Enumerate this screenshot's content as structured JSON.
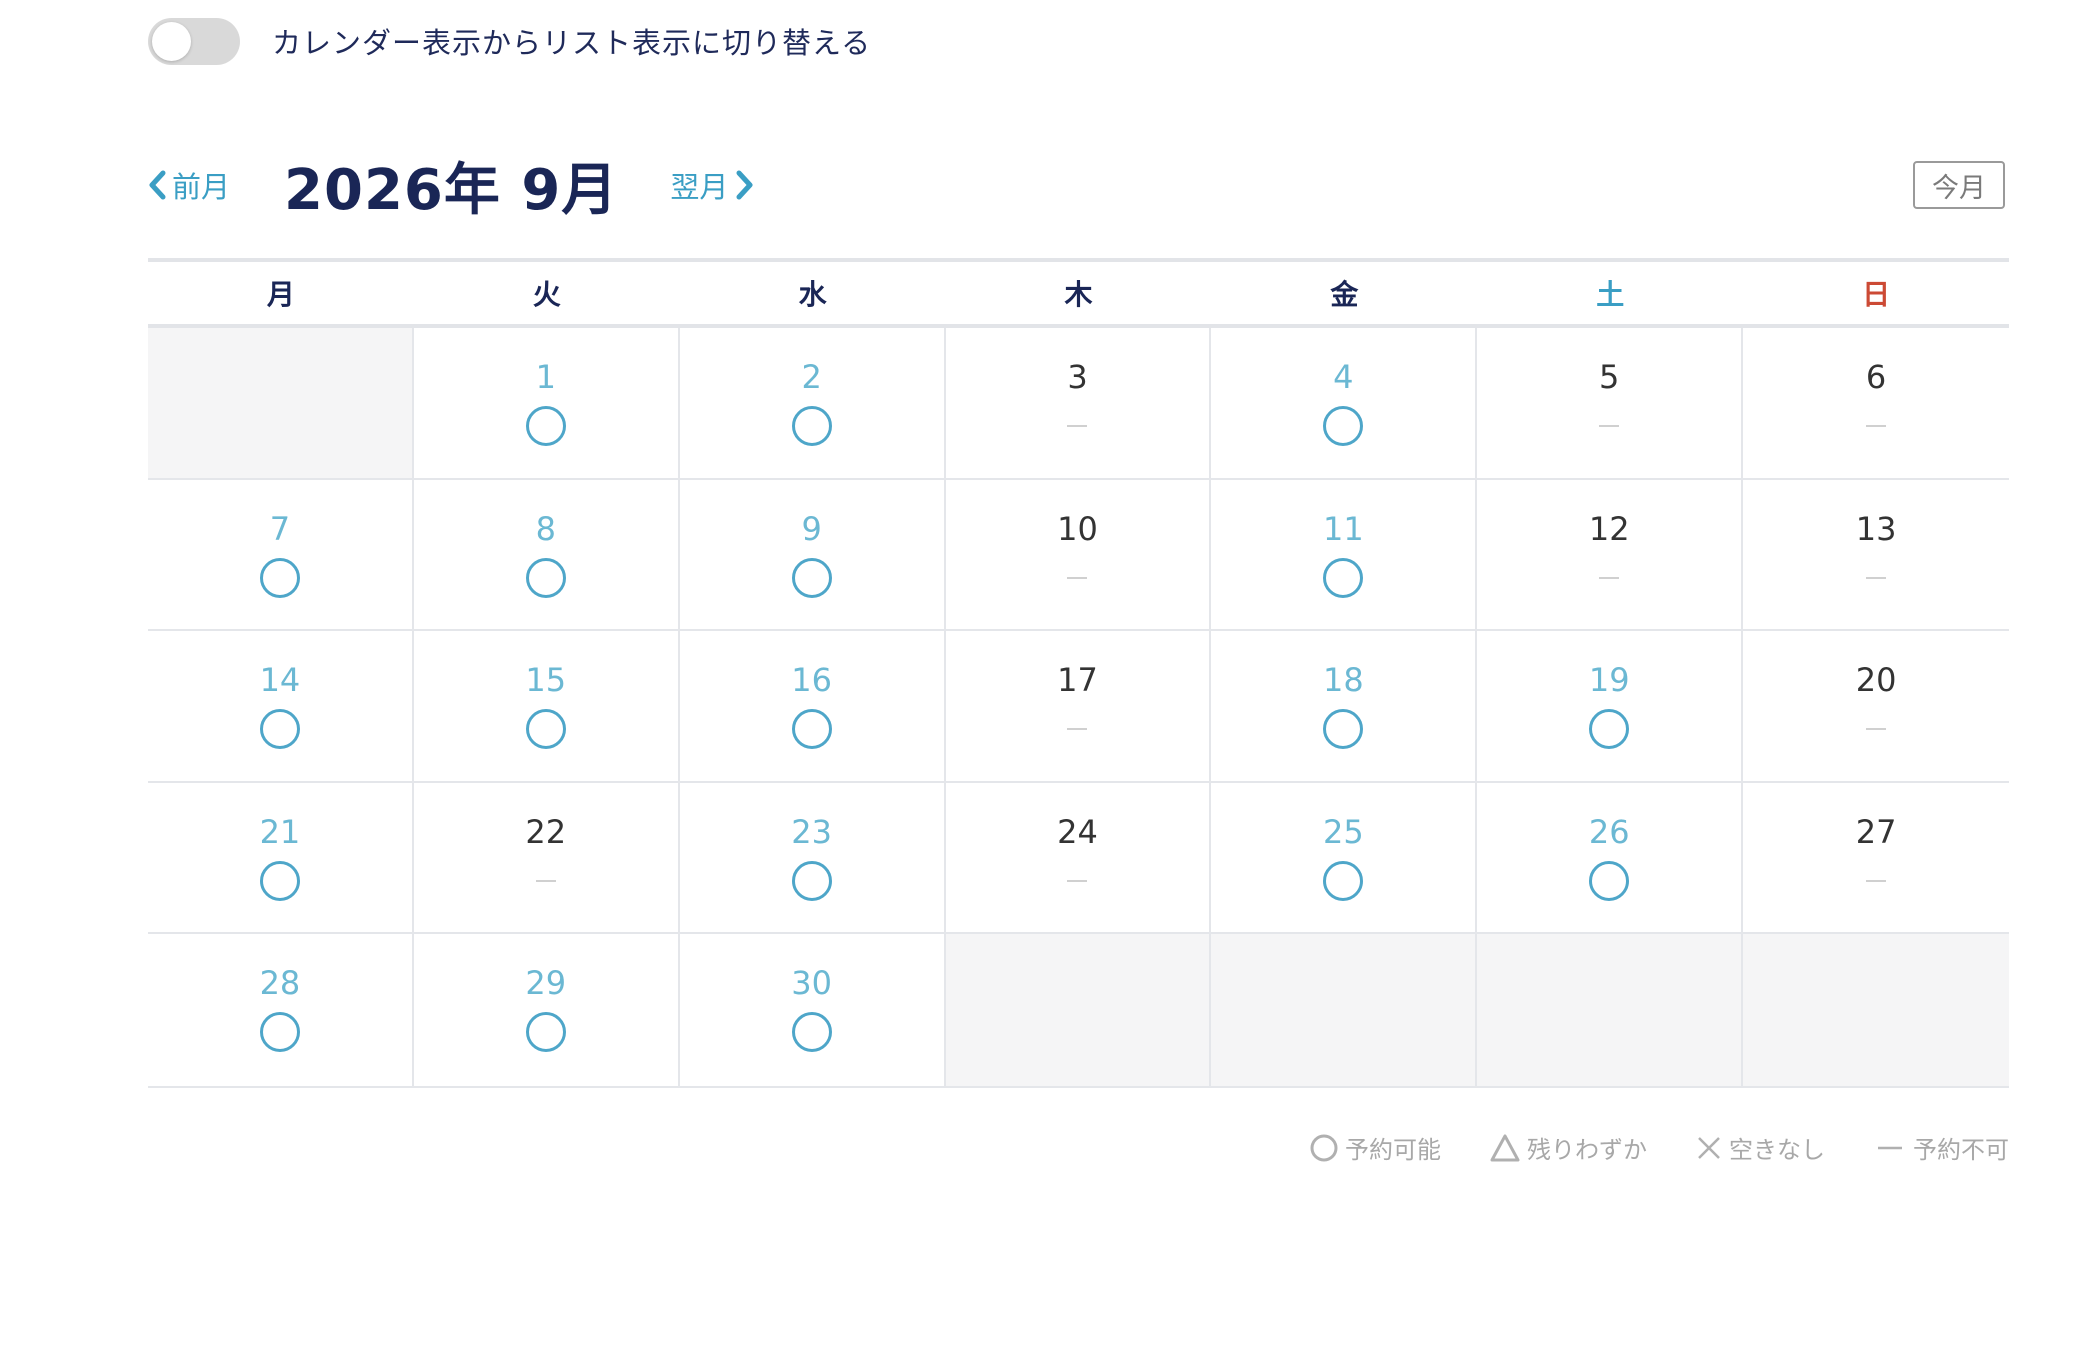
{
  "toggle": {
    "label": "カレンダー表示からリスト表示に切り替える",
    "on": false
  },
  "nav": {
    "prev_label": "前月",
    "next_label": "翌月",
    "month_title": "2026年 9月",
    "today_label": "今月"
  },
  "weekdays": [
    "月",
    "火",
    "水",
    "木",
    "金",
    "土",
    "日"
  ],
  "colors": {
    "accent": "#3a9ec4",
    "saturday": "#3a9ec4",
    "sunday": "#cc4a35",
    "title": "#1a2656",
    "empty_cell": "#f5f5f6"
  },
  "calendar": {
    "leading_empty": 1,
    "trailing_empty": 4,
    "days": [
      {
        "day": "1",
        "status": "available"
      },
      {
        "day": "2",
        "status": "available"
      },
      {
        "day": "3",
        "status": "unavailable"
      },
      {
        "day": "4",
        "status": "available"
      },
      {
        "day": "5",
        "status": "unavailable"
      },
      {
        "day": "6",
        "status": "unavailable"
      },
      {
        "day": "7",
        "status": "available"
      },
      {
        "day": "8",
        "status": "available"
      },
      {
        "day": "9",
        "status": "available"
      },
      {
        "day": "10",
        "status": "unavailable"
      },
      {
        "day": "11",
        "status": "available"
      },
      {
        "day": "12",
        "status": "unavailable"
      },
      {
        "day": "13",
        "status": "unavailable"
      },
      {
        "day": "14",
        "status": "available"
      },
      {
        "day": "15",
        "status": "available"
      },
      {
        "day": "16",
        "status": "available"
      },
      {
        "day": "17",
        "status": "unavailable"
      },
      {
        "day": "18",
        "status": "available"
      },
      {
        "day": "19",
        "status": "available"
      },
      {
        "day": "20",
        "status": "unavailable"
      },
      {
        "day": "21",
        "status": "available"
      },
      {
        "day": "22",
        "status": "unavailable"
      },
      {
        "day": "23",
        "status": "available"
      },
      {
        "day": "24",
        "status": "unavailable"
      },
      {
        "day": "25",
        "status": "available"
      },
      {
        "day": "26",
        "status": "available"
      },
      {
        "day": "27",
        "status": "unavailable"
      },
      {
        "day": "28",
        "status": "available"
      },
      {
        "day": "29",
        "status": "available"
      },
      {
        "day": "30",
        "status": "available"
      }
    ]
  },
  "legend": {
    "available": "予約可能",
    "few_left": "残りわずか",
    "full": "空きなし",
    "unavailable": "予約不可"
  }
}
